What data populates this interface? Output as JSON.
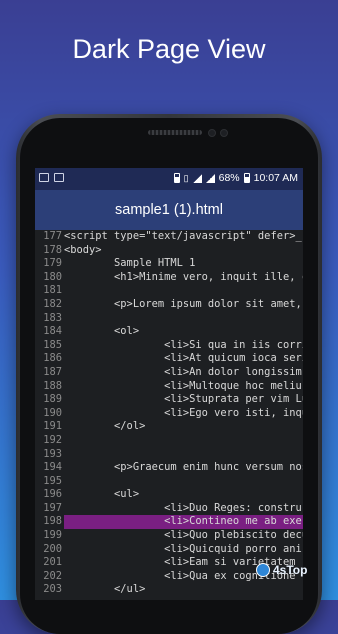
{
  "promo": {
    "title": "Dark Page View"
  },
  "statusbar": {
    "battery": "68%",
    "time": "10:07 AM"
  },
  "appbar": {
    "title": "sample1 (1).html"
  },
  "editor": {
    "highlight_line": "198",
    "lines": [
      {
        "n": "177",
        "text": "<script type=\"text/javascript\" defer>_"
      },
      {
        "n": "178",
        "text": "<body>"
      },
      {
        "n": "179",
        "text": "        Sample HTML 1"
      },
      {
        "n": "180",
        "text": "        <h1>Minime vero, inquit ille, c"
      },
      {
        "n": "181",
        "text": ""
      },
      {
        "n": "182",
        "text": "        <p>Lorem ipsum dolor sit amet, "
      },
      {
        "n": "183",
        "text": ""
      },
      {
        "n": "184",
        "text": "        <ol>"
      },
      {
        "n": "185",
        "text": "                <li>Si qua in iis corri"
      },
      {
        "n": "186",
        "text": "                <li>At quicum ioca seri"
      },
      {
        "n": "187",
        "text": "                <li>An dolor longissim"
      },
      {
        "n": "188",
        "text": "                <li>Multoque hoc meliu"
      },
      {
        "n": "189",
        "text": "                <li>Stuprata per vim Lu"
      },
      {
        "n": "190",
        "text": "                <li>Ego vero isti, inqu"
      },
      {
        "n": "191",
        "text": "        </ol>"
      },
      {
        "n": "192",
        "text": ""
      },
      {
        "n": "193",
        "text": ""
      },
      {
        "n": "194",
        "text": "        <p>Graecum enim hunc versum nos"
      },
      {
        "n": "195",
        "text": ""
      },
      {
        "n": "196",
        "text": "        <ul>"
      },
      {
        "n": "197",
        "text": "                <li>Duo Reges: constru"
      },
      {
        "n": "198",
        "text": "                <li>Contineo me ab exer"
      },
      {
        "n": "199",
        "text": "                <li>Quo plebiscito decu"
      },
      {
        "n": "200",
        "text": "                <li>Quicquid porro ani"
      },
      {
        "n": "201",
        "text": "                <li>Eam si varietatem"
      },
      {
        "n": "202",
        "text": "                <li>Qua ex cognitione"
      },
      {
        "n": "203",
        "text": "        </ul>"
      }
    ]
  },
  "watermark": {
    "text": "4sTop"
  }
}
